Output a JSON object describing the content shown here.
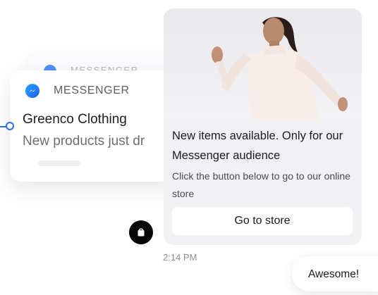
{
  "notification": {
    "app_name": "MESSENGER",
    "back_app_name": "MESSENGER",
    "title": "Greenco Clothing",
    "body": "New products just dr"
  },
  "message": {
    "title": "New items available. Only for our Messenger audience",
    "subtitle": "Click the button below to go to our online store",
    "button_label": "Go to store",
    "time": "2:14 PM"
  },
  "reply": {
    "text": "Awesome!"
  },
  "colors": {
    "messenger_blue": "#1b74f5",
    "card_bg": "#f1f1f4",
    "avatar_bg": "#050505"
  },
  "icons": [
    "messenger-logo-icon",
    "shopping-bag-icon"
  ]
}
